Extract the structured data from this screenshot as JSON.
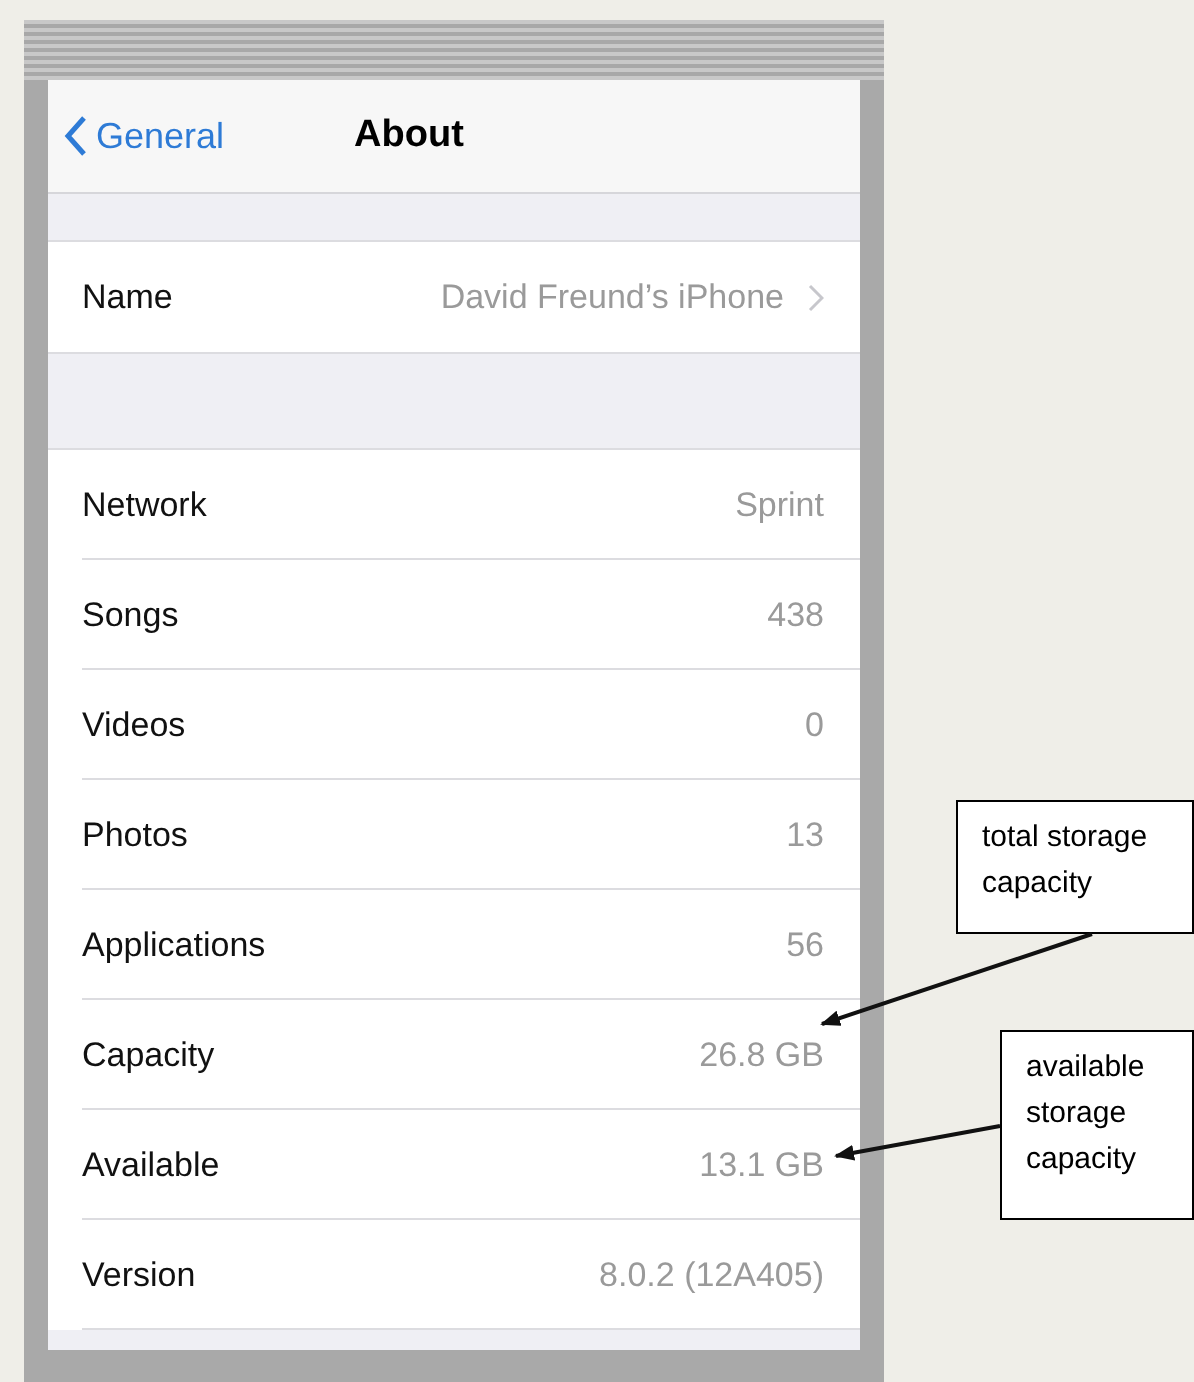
{
  "nav": {
    "back": "General",
    "title": "About"
  },
  "sections": [
    {
      "rows": [
        {
          "label": "Name",
          "value": "David Freund’s iPhone",
          "disclosure": true
        }
      ]
    },
    {
      "rows": [
        {
          "label": "Network",
          "value": "Sprint",
          "disclosure": false
        },
        {
          "label": "Songs",
          "value": "438",
          "disclosure": false
        },
        {
          "label": "Videos",
          "value": "0",
          "disclosure": false
        },
        {
          "label": "Photos",
          "value": "13",
          "disclosure": false
        },
        {
          "label": "Applications",
          "value": "56",
          "disclosure": false
        },
        {
          "label": "Capacity",
          "value": "26.8 GB",
          "disclosure": false
        },
        {
          "label": "Available",
          "value": "13.1 GB",
          "disclosure": false
        },
        {
          "label": "Version",
          "value": "8.0.2 (12A405)",
          "disclosure": false
        }
      ]
    }
  ],
  "callouts": [
    {
      "text": "total storage capacity"
    },
    {
      "text": "available storage capacity"
    }
  ]
}
